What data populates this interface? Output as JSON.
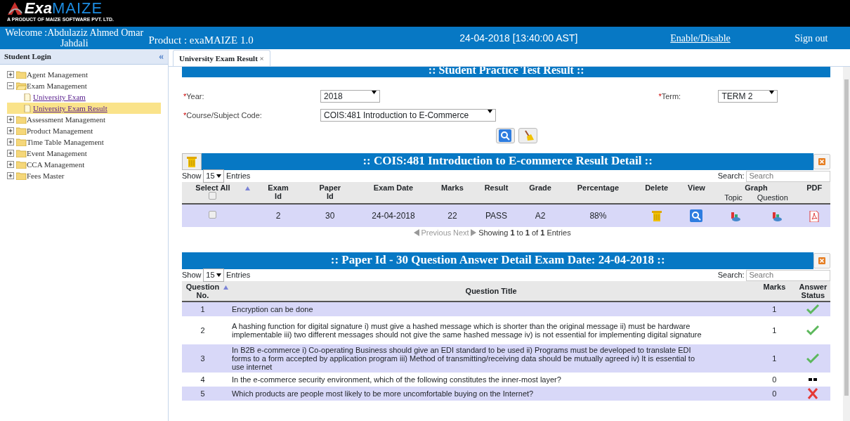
{
  "header": {
    "logo": {
      "part1": "Exa",
      "part2": "MAIZE",
      "tagline": "A PRODUCT OF MAIZE SOFTWARE PVT. LTD."
    }
  },
  "topbar": {
    "welcome": "Welcome :Abdulaziz Ahmed Omar Jahdali",
    "product": "Product : exaMAIZE 1.0",
    "datetime": "24-04-2018 [13:40:00 AST]",
    "links": [
      "Enable/Disable",
      "Sign out"
    ]
  },
  "sidebar": {
    "title": "Student Login",
    "collapse": "«",
    "tree": [
      {
        "label": "Agent Management",
        "expanded": false
      },
      {
        "label": "Exam Management",
        "expanded": true,
        "children": [
          {
            "label": "University Exam",
            "selected": false
          },
          {
            "label": "University Exam Result",
            "selected": true
          }
        ]
      },
      {
        "label": "Assessment Management",
        "expanded": false
      },
      {
        "label": "Product Management",
        "expanded": false
      },
      {
        "label": "Time Table Management",
        "expanded": false
      },
      {
        "label": "Event Management",
        "expanded": false
      },
      {
        "label": "CCA Management",
        "expanded": false
      },
      {
        "label": "Fees Master",
        "expanded": false
      }
    ]
  },
  "tabs": [
    {
      "label": "University Exam Result",
      "close": "×",
      "selected": true
    }
  ],
  "form": {
    "title": ":: Student Practice Test Result ::",
    "required_mark": "*",
    "year": {
      "label": "Year:",
      "value": "2018"
    },
    "term": {
      "label": "Term:",
      "value": "TERM 2"
    },
    "course": {
      "label": "Course/Subject Code:",
      "value": "COIS:481 Introduction to E-Commerce"
    }
  },
  "result_panel": {
    "title": ":: COIS:481 Introduction to E-commerce Result Detail ::",
    "show": "Show",
    "page_size": "15",
    "entries": "Entries",
    "search_label": "Search:",
    "search_placeholder": "Search",
    "select_all_checked": false,
    "columns": [
      "Select All",
      "Exam Id",
      "Paper Id",
      "Exam Date",
      "Marks",
      "Result",
      "Grade",
      "Percentage",
      "Delete",
      "View",
      "Graph",
      "PDF"
    ],
    "graph_subcolumns": [
      "Topic",
      "Question"
    ],
    "rows": [
      {
        "checked": false,
        "exam_id": "2",
        "paper_id": "30",
        "exam_date": "24-04-2018",
        "marks": "22",
        "result": "PASS",
        "grade": "A2",
        "percentage": "88%"
      }
    ],
    "pagination": {
      "previous": "Previous",
      "next": "Next",
      "info": "Showing **1** to **1** of **1** Entries"
    }
  },
  "answer_panel": {
    "title": ":: Paper Id - 30 Question Answer Detail Exam Date: 24-04-2018 ::",
    "show": "Show",
    "page_size": "15",
    "entries": "Entries",
    "search_label": "Search:",
    "search_placeholder": "Search",
    "columns": [
      "Question No.",
      "Question Title",
      "Marks",
      "Answer Status"
    ],
    "rows": [
      {
        "no": "1",
        "title": "Encryption can be done",
        "marks": "1",
        "kind": "correct"
      },
      {
        "no": "2",
        "title": "A hashing function for digital signature i) must give a hashed message which is shorter than the original message ii) must be hardware implementable iii) two different messages should not give the same hashed message iv) is not essential for implementing digital signature",
        "marks": "1",
        "kind": "correct"
      },
      {
        "no": "3",
        "title": "In B2B e-commerce i) Co-operating Business should give an EDI standard to be used ii) Programs must be developed to translate EDI forms to a form accepted by application program iii) Method of transmitting/receiving data should be mutually agreed iv) It is essential to use internet",
        "marks": "1",
        "kind": "correct"
      },
      {
        "no": "4",
        "title": "In the e-commerce security environment, which of the following constitutes the inner-most layer?",
        "marks": "0",
        "kind": "unanswered"
      },
      {
        "no": "5",
        "title": "Which products are people most likely to be more uncomfortable buying on the Internet?",
        "marks": "0",
        "kind": "wrong"
      }
    ]
  }
}
